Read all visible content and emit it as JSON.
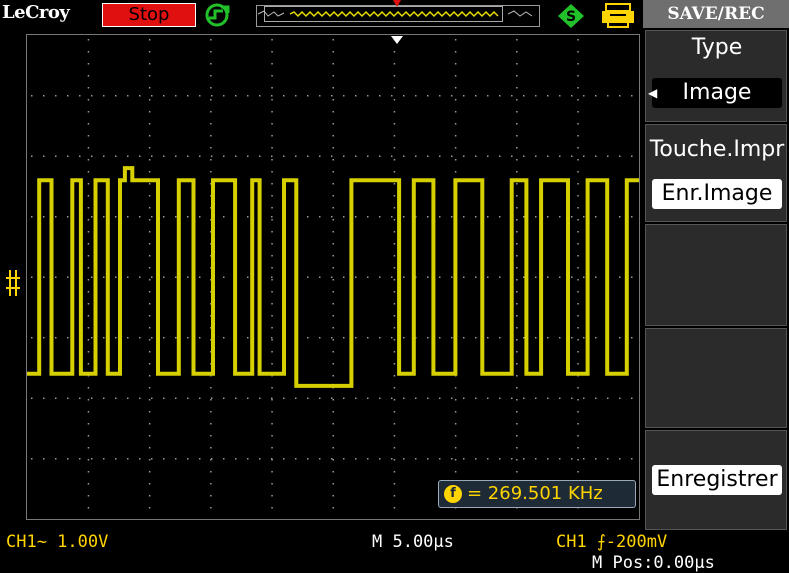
{
  "topbar": {
    "brand": "LeCroy",
    "run_state": "Stop"
  },
  "menu": {
    "title": "SAVE/REC",
    "items": [
      {
        "label": "Type",
        "value": "Image"
      },
      {
        "label": "Touche.Impr",
        "value": "Enr.Image"
      },
      {
        "label": "",
        "value": ""
      },
      {
        "label": "",
        "value": ""
      },
      {
        "label": "",
        "value": "Enregistrer"
      }
    ]
  },
  "measurement": {
    "frequency": "= 269.501 KHz",
    "icon_letter": "f"
  },
  "status": {
    "ch1_scale": "CH1~ 1.00V",
    "timebase": "M 5.00µs",
    "trigger": "CH1 ⨍-200mV",
    "mpos": "M Pos:0.00µs"
  },
  "colors": {
    "trace": "#d6d000",
    "stop_bg": "#e01010",
    "label": "#ffd400",
    "grid": "#9a9a9a"
  },
  "chart_data": {
    "type": "line",
    "x": [
      0,
      0.5,
      0.5,
      1.0,
      1.0,
      1.85,
      1.85,
      2.2,
      2.2,
      2.8,
      2.8,
      3.3,
      3.3,
      3.8,
      3.8,
      4.0,
      4.0,
      4.3,
      4.3,
      5.35,
      5.35,
      6.2,
      6.2,
      6.8,
      6.8,
      7.6,
      7.6,
      8.5,
      8.5,
      9.2,
      9.2,
      9.5,
      9.5,
      10.5,
      10.5,
      11.0,
      11.0,
      13.25,
      13.25,
      15.2,
      15.2,
      15.8,
      15.8,
      16.6,
      16.6,
      17.5,
      17.5,
      18.6,
      18.6,
      19.8,
      19.8,
      20.4,
      20.4,
      21.0,
      21.0,
      22.1,
      22.1,
      22.9,
      22.9,
      23.7,
      23.7,
      24.5,
      24.5,
      25.0
    ],
    "y": [
      -1.6,
      -1.6,
      1.6,
      1.6,
      -1.6,
      -1.6,
      1.6,
      1.6,
      -1.6,
      -1.6,
      1.6,
      1.6,
      -1.6,
      -1.6,
      1.6,
      1.6,
      1.8,
      1.8,
      1.6,
      1.6,
      -1.6,
      -1.6,
      1.6,
      1.6,
      -1.6,
      -1.6,
      1.6,
      1.6,
      -1.6,
      -1.6,
      1.6,
      1.6,
      -1.6,
      -1.6,
      1.6,
      1.6,
      -1.8,
      -1.8,
      1.6,
      1.6,
      -1.6,
      -1.6,
      1.6,
      1.6,
      -1.6,
      -1.6,
      1.6,
      1.6,
      -1.6,
      -1.6,
      1.6,
      1.6,
      -1.6,
      -1.6,
      1.6,
      1.6,
      -1.6,
      -1.6,
      1.6,
      1.6,
      -1.6,
      -1.6,
      1.6,
      1.6
    ],
    "xlim": [
      0,
      25
    ],
    "ylim": [
      -4,
      4
    ],
    "grid": true,
    "xlabel": "",
    "ylabel": "",
    "series": [
      {
        "name": "CH1"
      }
    ]
  }
}
